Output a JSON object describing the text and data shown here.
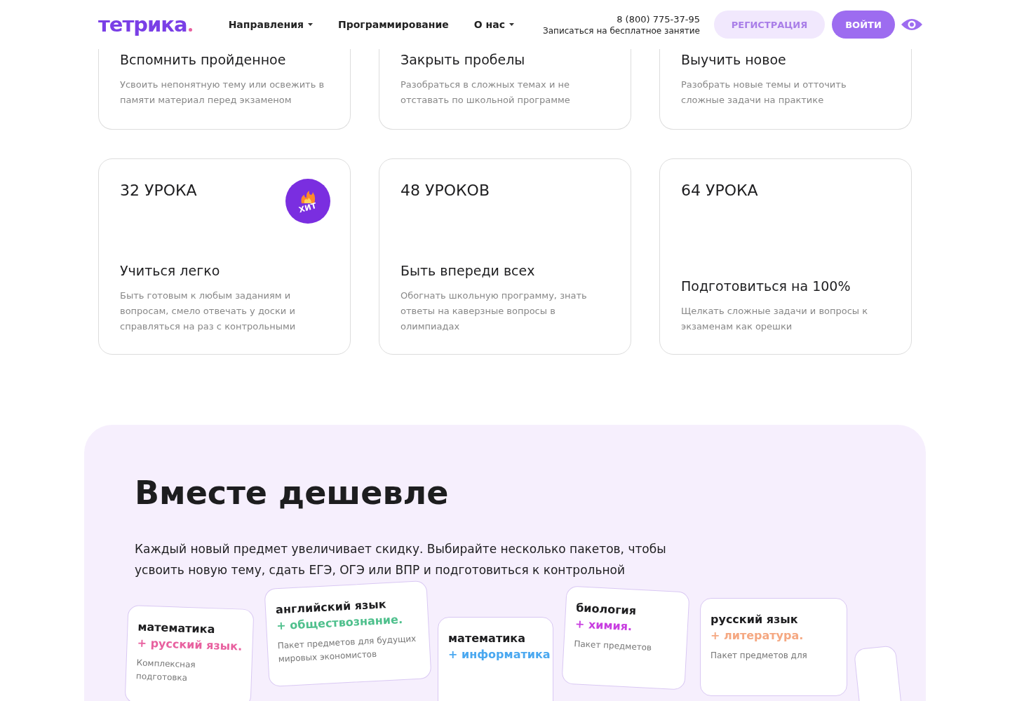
{
  "header": {
    "logo": "тетрика",
    "nav": [
      {
        "label": "Направления",
        "dropdown": true
      },
      {
        "label": "Программирование",
        "dropdown": false
      },
      {
        "label": "О нас",
        "dropdown": true
      }
    ],
    "phone": "8 (800) 775-37-95",
    "trial": "Записаться на бесплатное занятие",
    "register": "РЕГИСТРАЦИЯ",
    "login": "ВОЙТИ"
  },
  "goals": [
    {
      "title": "Вспомнить пройденное",
      "text": "Усвоить непонятную тему или освежить в памяти материал перед экзаменом"
    },
    {
      "title": "Закрыть пробелы",
      "text": "Разобраться в сложных темах и не отставать по школьной программе"
    },
    {
      "title": "Выучить новое",
      "text": "Разобрать новые темы и отточить сложные задачи на практике"
    }
  ],
  "packages": [
    {
      "lessons": "32 УРОКА",
      "badge": "ХИТ",
      "title": "Учиться легко",
      "text": "Быть готовым к любым заданиям и вопросам, смело отвечать у доски и справляться на раз с контрольными"
    },
    {
      "lessons": "48 УРОКОВ",
      "title": "Быть впереди всех",
      "text": "Обогнать школьную программу, знать ответы на каверзные вопросы в олимпиадах"
    },
    {
      "lessons": "64 УРОКА",
      "title": "Подготовиться на 100%",
      "text": "Щелкать сложные задачи и вопросы к экзаменам как орешки"
    }
  ],
  "together": {
    "title": "Вместе дешевле",
    "text": "Каждый новый предмет увеличивает скидку. Выбирайте несколько пакетов, чтобы усвоить новую тему, сдать ЕГЭ, ОГЭ или ВПР и подготовиться к контрольной",
    "bundles": [
      {
        "subject": "математика",
        "extra": "+ русский язык.",
        "color": "#e8609f",
        "text": "Комплексная подготовка"
      },
      {
        "subject": "английский язык",
        "extra": "+ обществознание.",
        "color": "#4fc08d",
        "text": "Пакет предметов для будущих мировых экономистов"
      },
      {
        "subject": "математика",
        "extra": "+ информатика",
        "color": "#4aa8f0"
      },
      {
        "subject": "биология",
        "extra": "+ химия.",
        "color": "#c83ee0",
        "text": "Пакет предметов"
      },
      {
        "subject": "русский язык",
        "extra": "+ литература.",
        "color": "#f5a882",
        "text": "Пакет предметов для"
      }
    ]
  }
}
